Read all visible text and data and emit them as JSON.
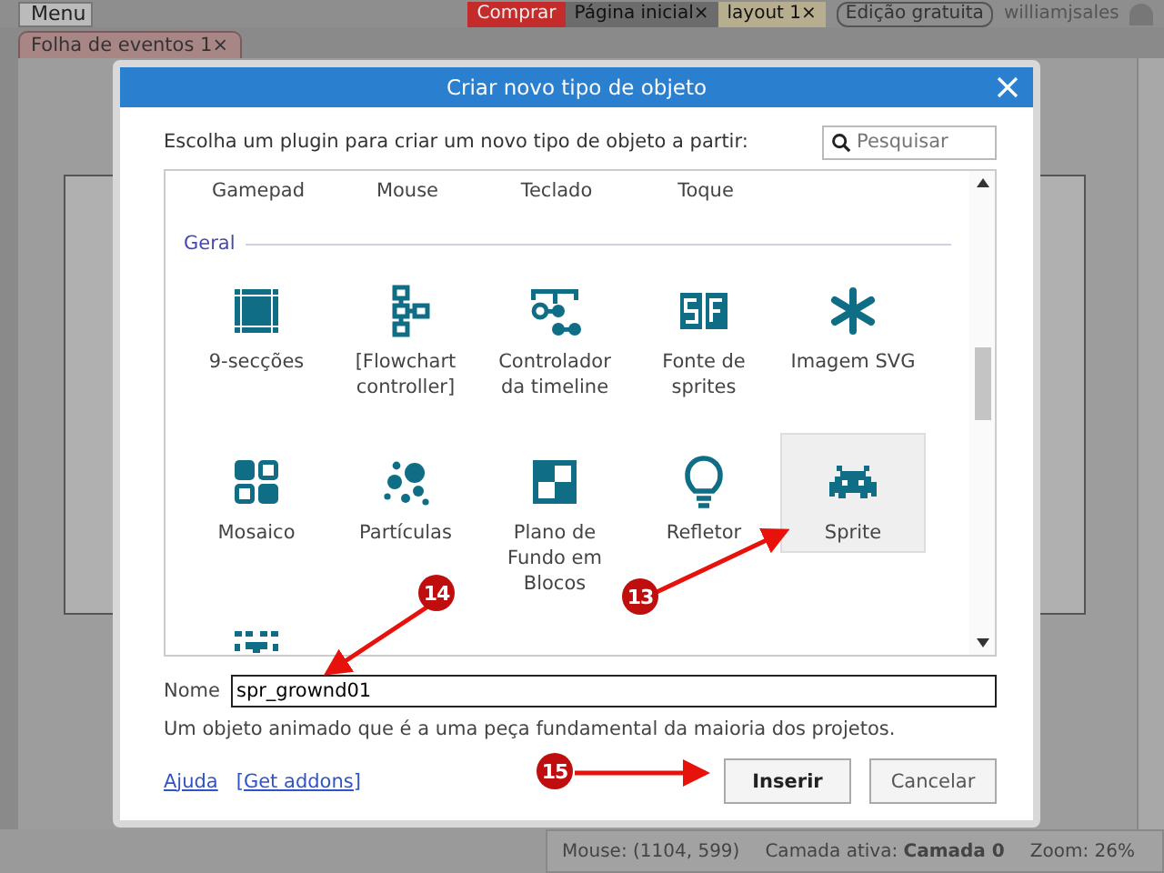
{
  "top_bar": {
    "menu": "Menu",
    "tabs": [
      {
        "label": "Comprar",
        "kind": "buy",
        "selected": false
      },
      {
        "label": "Página inicial",
        "kind": "tab",
        "close": "×",
        "selected": false
      },
      {
        "label": "layout 1",
        "kind": "tab",
        "close": "×",
        "selected": true
      }
    ],
    "edition": "Edição gratuita",
    "user": "williamjsales"
  },
  "doc_tabs": [
    {
      "label": "Folha de eventos 1",
      "close": "×",
      "selected": true
    }
  ],
  "dialog": {
    "title": "Criar novo tipo de objeto",
    "prompt": "Escolha um plugin para criar um novo tipo de objeto a partir:",
    "search": {
      "placeholder": "Pesquisar"
    },
    "previous_row": [
      "Gamepad",
      "Mouse",
      "Teclado",
      "Toque"
    ],
    "group": "Geral",
    "plugins": [
      {
        "label": "9-secções",
        "selected": false
      },
      {
        "label": "[Flowchart controller]",
        "selected": false
      },
      {
        "label": "Controlador da timeline",
        "selected": false
      },
      {
        "label": "Fonte de sprites",
        "selected": false
      },
      {
        "label": "Imagem SVG",
        "selected": false
      },
      {
        "label": "Mosaico",
        "selected": false
      },
      {
        "label": "Partículas",
        "selected": false
      },
      {
        "label": "Plano de Fundo em Blocos",
        "selected": false
      },
      {
        "label": "Refletor",
        "selected": false
      },
      {
        "label": "Sprite",
        "selected": true
      },
      {
        "selected": false
      }
    ],
    "name_label": "Nome",
    "name_value": "spr_grownd01",
    "description": "Um objeto animado que é a uma peça fundamental da maioria dos projetos.",
    "links": [
      "Ajuda",
      "[Get addons]"
    ],
    "buttons": [
      {
        "label": "Inserir",
        "kind": "primary"
      },
      {
        "label": "Cancelar",
        "kind": "secondary"
      }
    ]
  },
  "annotations": [
    "13",
    "14",
    "15"
  ],
  "status_bar": {
    "mouse": "Mouse: (1104, 599)",
    "layer": "Camada ativa: **Camada 0**",
    "zoom": "Zoom: 26%"
  }
}
